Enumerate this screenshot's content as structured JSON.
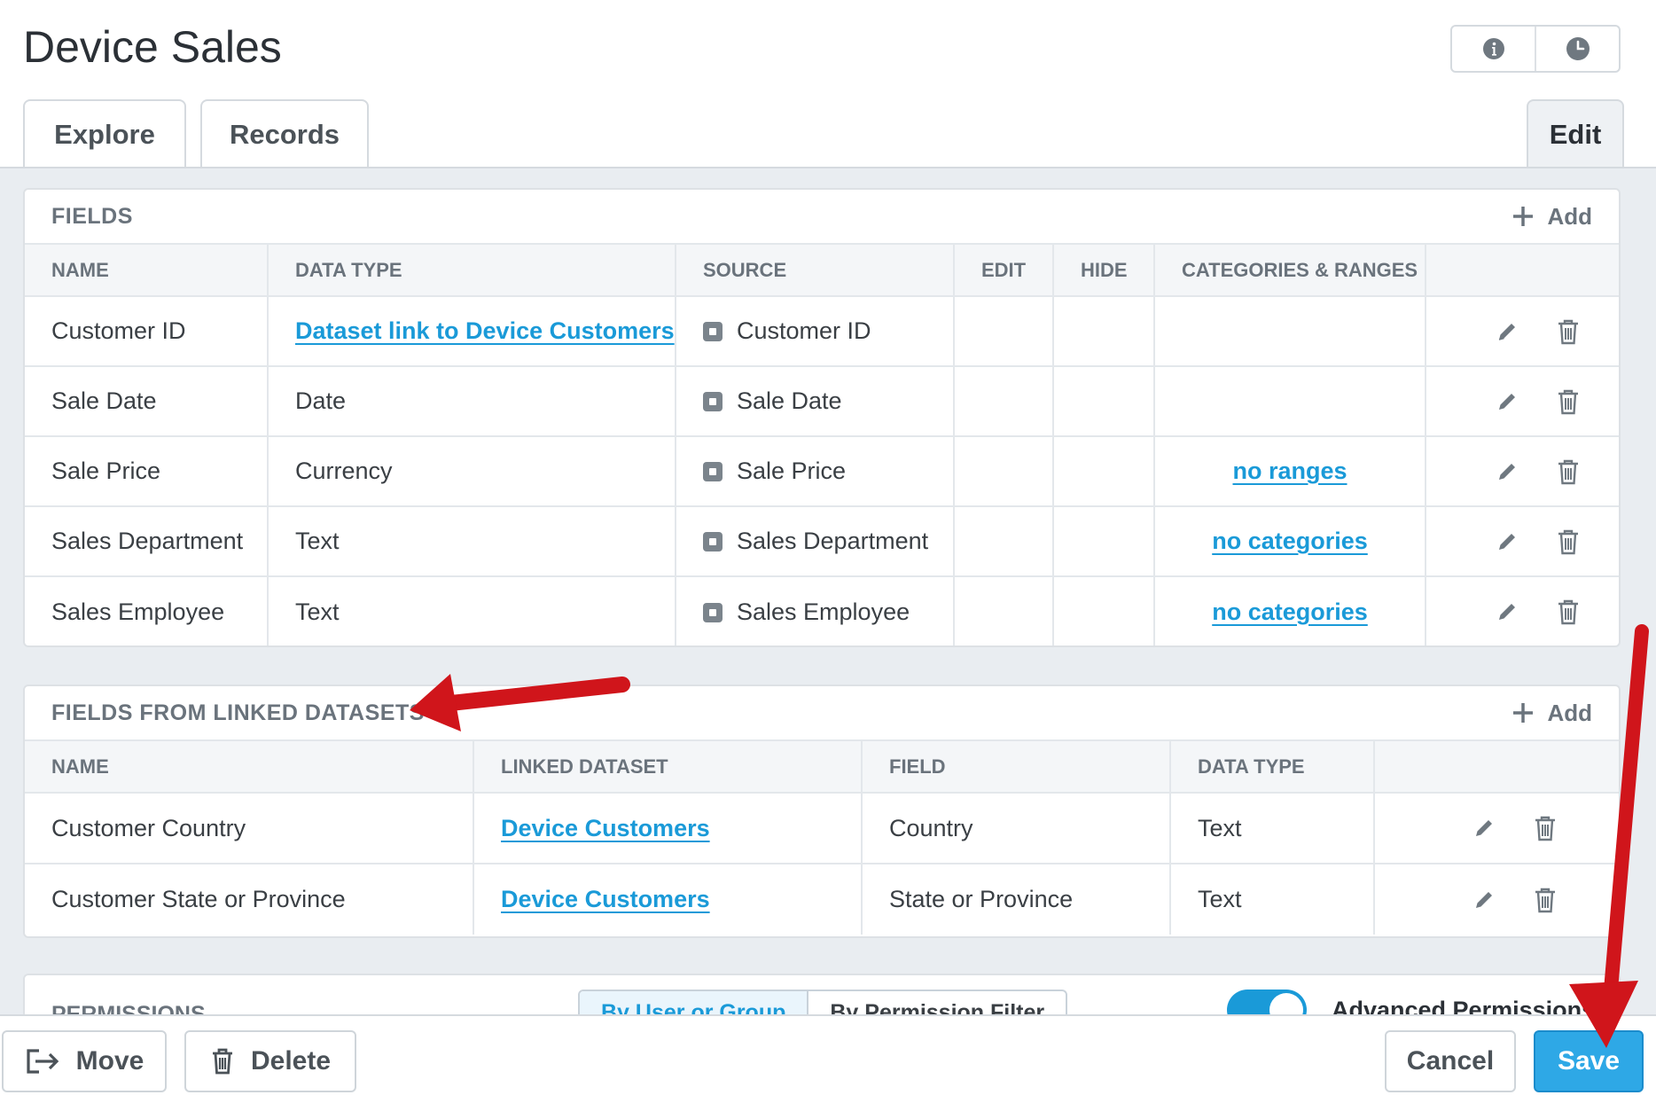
{
  "header": {
    "title": "Device Sales",
    "icons": [
      "info-icon",
      "clock-icon"
    ]
  },
  "tabs": {
    "explore": "Explore",
    "records": "Records",
    "edit": "Edit"
  },
  "fields": {
    "title": "FIELDS",
    "add_label": "Add",
    "columns": [
      "NAME",
      "DATA TYPE",
      "SOURCE",
      "EDIT",
      "HIDE",
      "CATEGORIES & RANGES",
      ""
    ],
    "rows": [
      {
        "name": "Customer ID",
        "data_type": "Dataset link to Device Customers",
        "data_type_is_link": true,
        "source": "Customer ID",
        "categories": ""
      },
      {
        "name": "Sale Date",
        "data_type": "Date",
        "source": "Sale Date",
        "categories": ""
      },
      {
        "name": "Sale Price",
        "data_type": "Currency",
        "source": "Sale Price",
        "categories": "no ranges"
      },
      {
        "name": "Sales Department",
        "data_type": "Text",
        "source": "Sales Department",
        "categories": "no categories"
      },
      {
        "name": "Sales Employee",
        "data_type": "Text",
        "source": "Sales Employee",
        "categories": "no categories"
      }
    ]
  },
  "linked": {
    "title": "FIELDS FROM LINKED DATASETS",
    "add_label": "Add",
    "columns": [
      "NAME",
      "LINKED DATASET",
      "FIELD",
      "DATA TYPE",
      ""
    ],
    "rows": [
      {
        "name": "Customer Country",
        "linked_dataset": "Device Customers",
        "field": "Country",
        "data_type": "Text"
      },
      {
        "name": "Customer State or Province",
        "linked_dataset": "Device Customers",
        "field": "State or Province",
        "data_type": "Text"
      }
    ]
  },
  "permissions": {
    "title": "PERMISSIONS",
    "segment_on": "By User or Group",
    "segment_off": "By Permission Filter",
    "toggle_label": "Advanced Permissions"
  },
  "footer": {
    "move": "Move",
    "delete": "Delete",
    "cancel": "Cancel",
    "save": "Save"
  },
  "colors": {
    "accent": "#1a9ad8",
    "save_button": "#2ea8e6",
    "annotation_arrow": "#d0151b",
    "content_bg": "#e9edf1"
  }
}
